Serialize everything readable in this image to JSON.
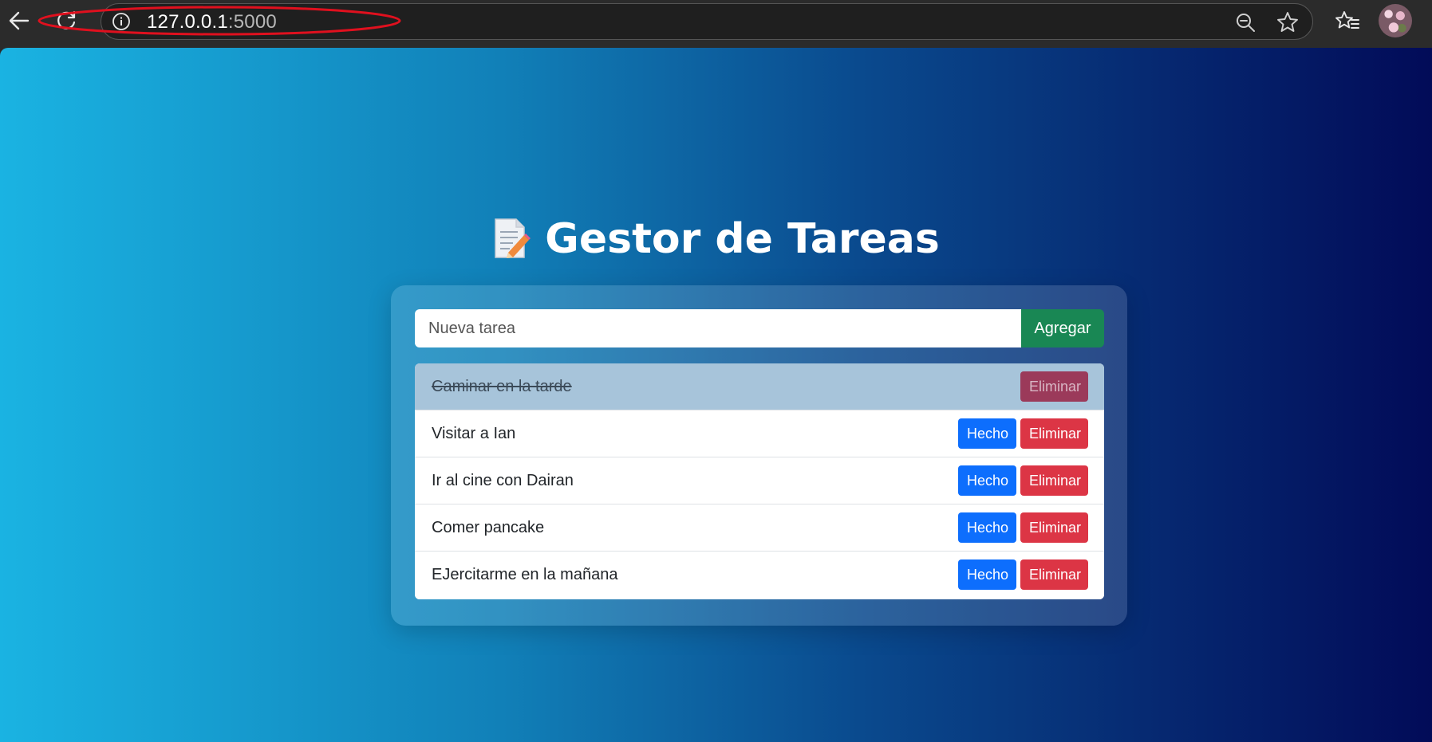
{
  "browser": {
    "url_host": "127.0.0.1",
    "url_port": ":5000",
    "icons": {
      "back": "arrow-left-icon",
      "reload": "reload-icon",
      "info": "info-icon",
      "zoom": "zoom-out-icon",
      "favorite": "star-icon",
      "favorites_menu": "favorites-list-icon",
      "profile": "avatar"
    },
    "annotation_color": "#e0101e"
  },
  "page": {
    "title": "Gestor de Tareas",
    "title_icon": "memo-icon",
    "background_colors": [
      "#1ab3e2",
      "#020b58"
    ]
  },
  "form": {
    "placeholder": "Nueva tarea",
    "value": "",
    "add_label": "Agregar",
    "add_color": "#198754"
  },
  "tasks": [
    {
      "text": "Caminar en la tarde",
      "done": true,
      "delete_label": "Eliminar"
    },
    {
      "text": "Visitar a Ian",
      "done": false,
      "done_label": "Hecho",
      "delete_label": "Eliminar"
    },
    {
      "text": "Ir al cine con Dairan",
      "done": false,
      "done_label": "Hecho",
      "delete_label": "Eliminar"
    },
    {
      "text": "Comer pancake",
      "done": false,
      "done_label": "Hecho",
      "delete_label": "Eliminar"
    },
    {
      "text": "EJercitarme en la mañana",
      "done": false,
      "done_label": "Hecho",
      "delete_label": "Eliminar"
    }
  ],
  "colors": {
    "done_button": "#0d6efd",
    "delete_button": "#dc3545"
  }
}
